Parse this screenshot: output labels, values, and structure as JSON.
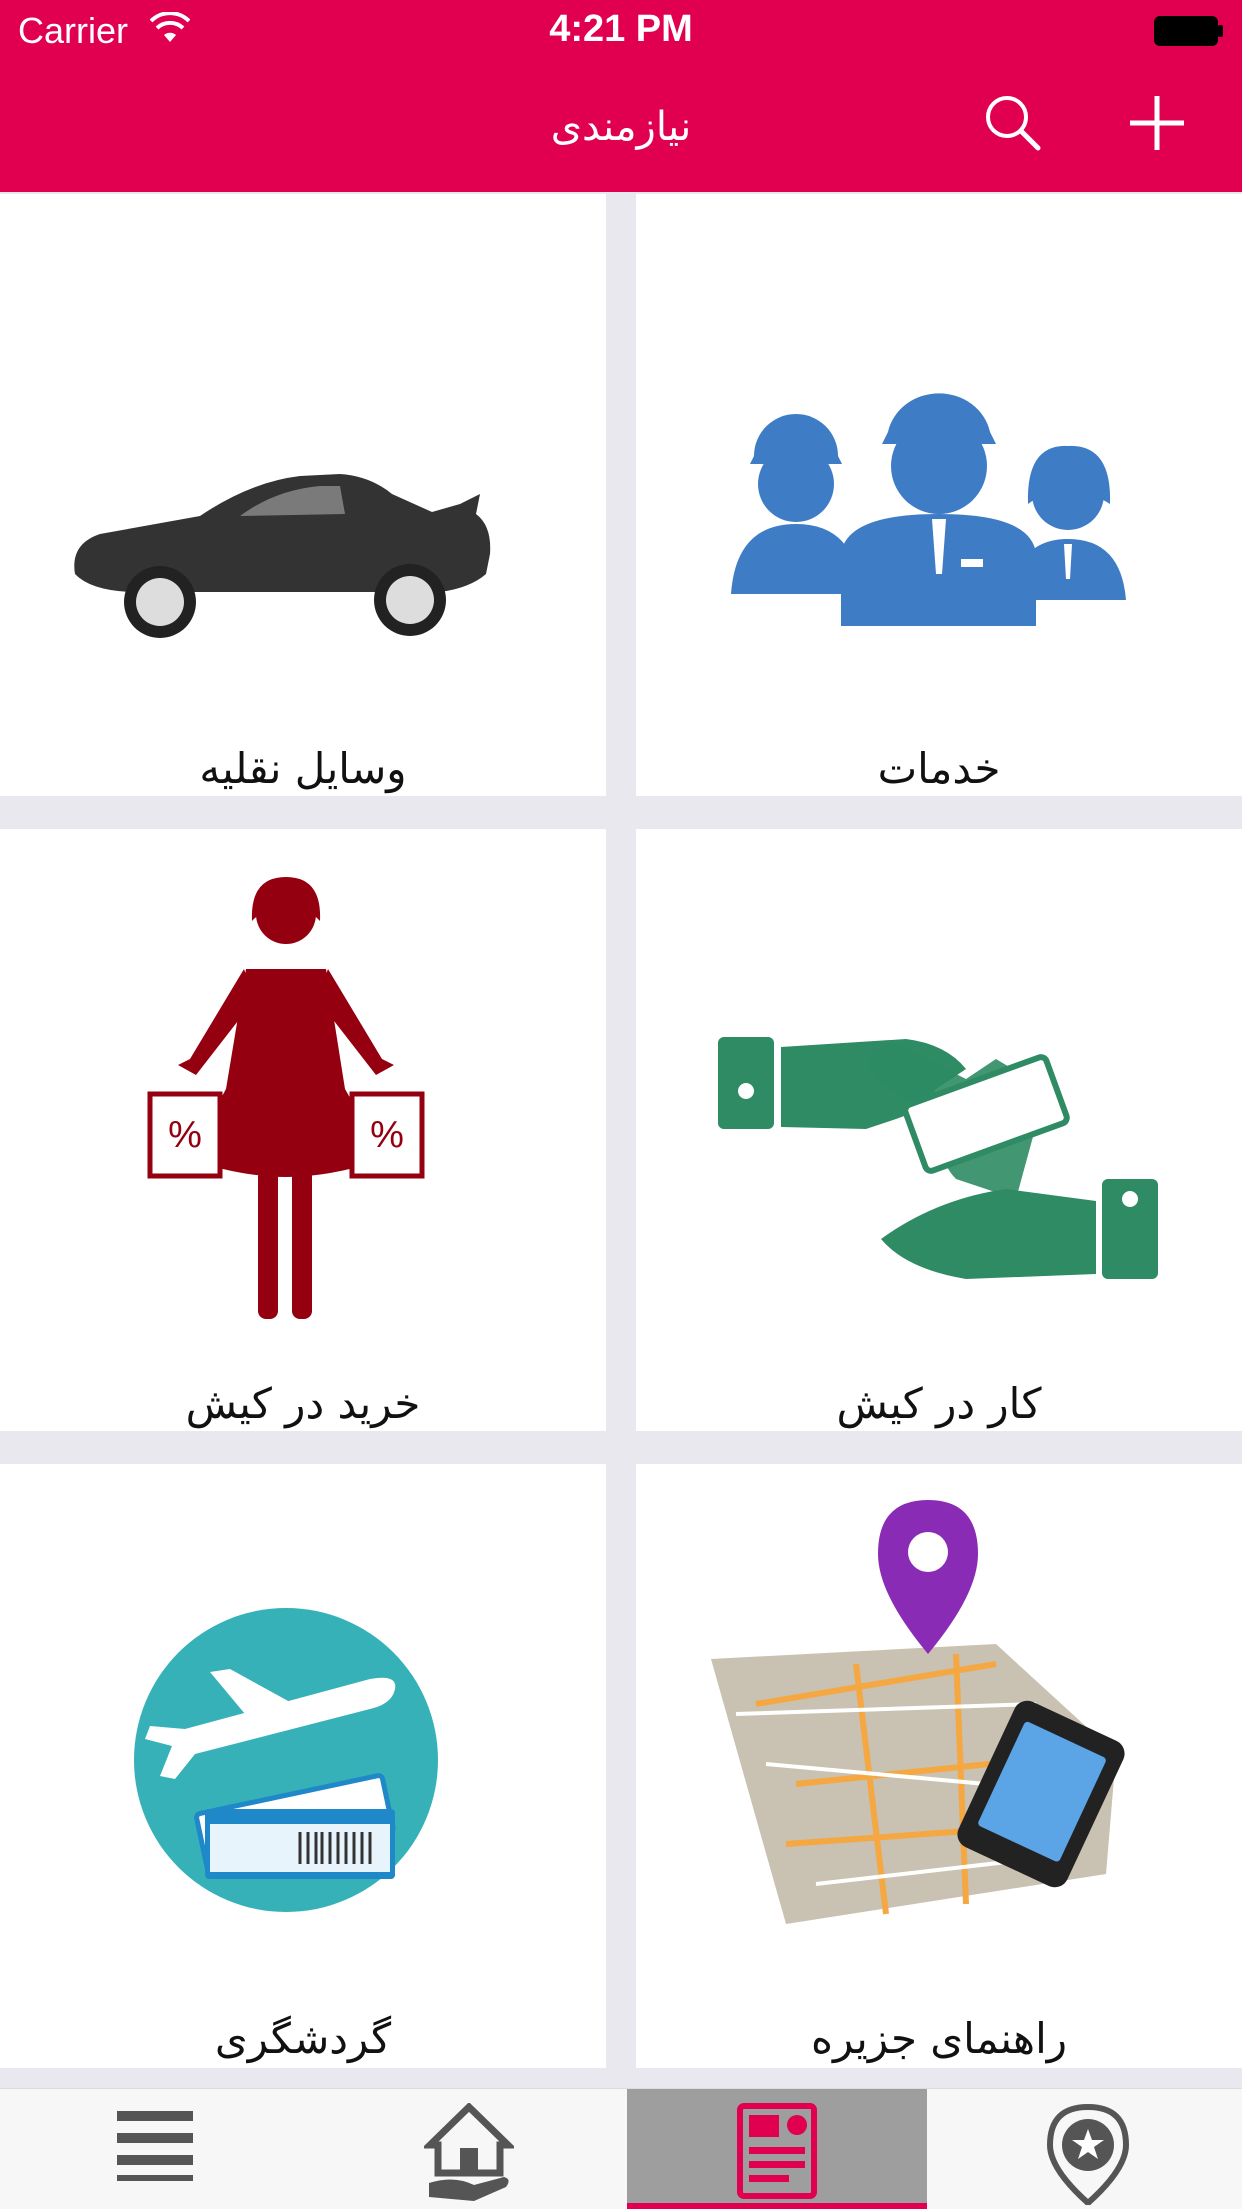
{
  "status_bar": {
    "carrier": "Carrier",
    "time": "4:21 PM"
  },
  "header": {
    "title": "نیازمندی",
    "search_icon": "search-icon",
    "add_icon": "plus-icon",
    "color": "#e0004f"
  },
  "tiles": [
    {
      "label": "خدمات",
      "icon": "workers-icon"
    },
    {
      "label": "وسایل نقلیه",
      "icon": "car-icon"
    },
    {
      "label": "کار در کیش",
      "icon": "money-hands-icon"
    },
    {
      "label": "خرید در کیش",
      "icon": "shopping-woman-icon"
    },
    {
      "label": "راهنمای جزیره",
      "icon": "map-phone-icon"
    },
    {
      "label": "گردشگری",
      "icon": "plane-ticket-icon"
    }
  ],
  "tabbar": {
    "items": [
      {
        "icon": "menu-icon",
        "active": false
      },
      {
        "icon": "home-hand-icon",
        "active": false
      },
      {
        "icon": "listing-icon",
        "active": true
      },
      {
        "icon": "location-star-icon",
        "active": false
      }
    ]
  }
}
